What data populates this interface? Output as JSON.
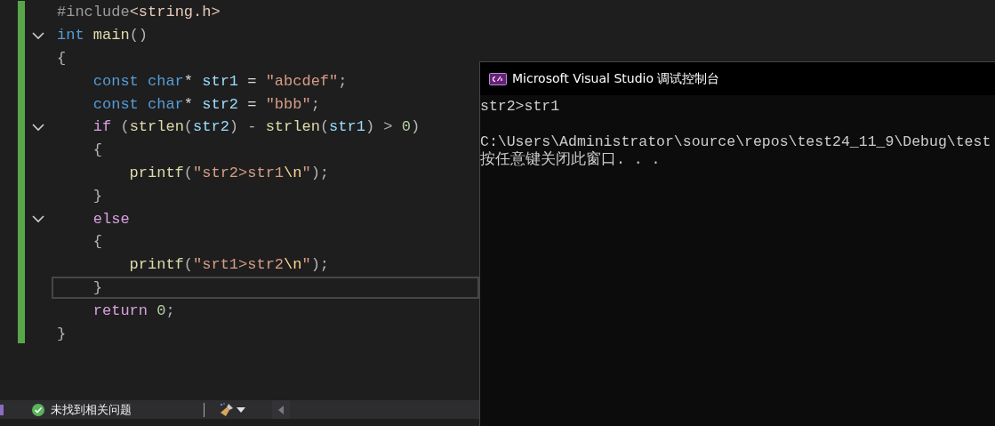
{
  "editor": {
    "lines": [
      {
        "current": false,
        "tokens": [
          {
            "t": "#include",
            "kind": "preproc"
          },
          {
            "t": "<string.h>",
            "kind": "include"
          }
        ]
      },
      {
        "expanded": true,
        "current": false,
        "tokens": [
          {
            "t": "int",
            "kind": "keyword"
          },
          {
            "t": " main",
            "kind": "func"
          },
          {
            "t": "()",
            "kind": "punct"
          }
        ]
      },
      {
        "current": false,
        "tokens": [
          {
            "t": "{",
            "kind": "punct"
          }
        ]
      },
      {
        "current": false,
        "tokens": [
          {
            "t": "    const char",
            "kind": "keyword"
          },
          {
            "t": "* ",
            "kind": "plain"
          },
          {
            "t": "str1",
            "kind": "var"
          },
          {
            "t": " = ",
            "kind": "plain"
          },
          {
            "t": "\"abcdef\"",
            "kind": "string"
          },
          {
            "t": ";",
            "kind": "punct"
          }
        ]
      },
      {
        "current": false,
        "tokens": [
          {
            "t": "    const char",
            "kind": "keyword"
          },
          {
            "t": "* ",
            "kind": "plain"
          },
          {
            "t": "str2",
            "kind": "var"
          },
          {
            "t": " = ",
            "kind": "plain"
          },
          {
            "t": "\"bbb\"",
            "kind": "string"
          },
          {
            "t": ";",
            "kind": "punct"
          }
        ]
      },
      {
        "expanded": true,
        "current": false,
        "tokens": [
          {
            "t": "    if",
            "kind": "control"
          },
          {
            "t": " (",
            "kind": "punct"
          },
          {
            "t": "strlen",
            "kind": "func"
          },
          {
            "t": "(",
            "kind": "punct"
          },
          {
            "t": "str2",
            "kind": "var"
          },
          {
            "t": ") - ",
            "kind": "punct"
          },
          {
            "t": "strlen",
            "kind": "func"
          },
          {
            "t": "(",
            "kind": "punct"
          },
          {
            "t": "str1",
            "kind": "var"
          },
          {
            "t": ") > ",
            "kind": "punct"
          },
          {
            "t": "0",
            "kind": "number"
          },
          {
            "t": ")",
            "kind": "punct"
          }
        ]
      },
      {
        "current": false,
        "tokens": [
          {
            "t": "    {",
            "kind": "punct"
          }
        ]
      },
      {
        "current": false,
        "tokens": [
          {
            "t": "        printf",
            "kind": "func"
          },
          {
            "t": "(",
            "kind": "punct"
          },
          {
            "t": "\"str2>str1",
            "kind": "string"
          },
          {
            "t": "\\n",
            "kind": "escape"
          },
          {
            "t": "\"",
            "kind": "string"
          },
          {
            "t": ");",
            "kind": "punct"
          }
        ]
      },
      {
        "current": false,
        "tokens": [
          {
            "t": "    }",
            "kind": "punct"
          }
        ]
      },
      {
        "expanded": true,
        "current": false,
        "tokens": [
          {
            "t": "    else",
            "kind": "control"
          }
        ]
      },
      {
        "current": false,
        "tokens": [
          {
            "t": "    {",
            "kind": "punct"
          }
        ]
      },
      {
        "current": false,
        "tokens": [
          {
            "t": "        printf",
            "kind": "func"
          },
          {
            "t": "(",
            "kind": "punct"
          },
          {
            "t": "\"srt1>str2",
            "kind": "string"
          },
          {
            "t": "\\n",
            "kind": "escape"
          },
          {
            "t": "\"",
            "kind": "string"
          },
          {
            "t": ");",
            "kind": "punct"
          }
        ]
      },
      {
        "current": true,
        "tokens": [
          {
            "t": "    }",
            "kind": "punct"
          }
        ]
      },
      {
        "current": false,
        "tokens": [
          {
            "t": "    return",
            "kind": "control"
          },
          {
            "t": " 0",
            "kind": "number"
          },
          {
            "t": ";",
            "kind": "punct"
          }
        ]
      },
      {
        "current": false,
        "tokens": [
          {
            "t": "}",
            "kind": "punct"
          }
        ]
      }
    ]
  },
  "status_bar": {
    "issues": "未找到相关问题"
  },
  "console": {
    "title": "Microsoft Visual Studio 调试控制台",
    "output": [
      "str2>str1"
    ],
    "footer": [
      "C:\\Users\\Administrator\\source\\repos\\test24_11_9\\Debug\\test",
      "按任意键关闭此窗口. . ."
    ]
  }
}
